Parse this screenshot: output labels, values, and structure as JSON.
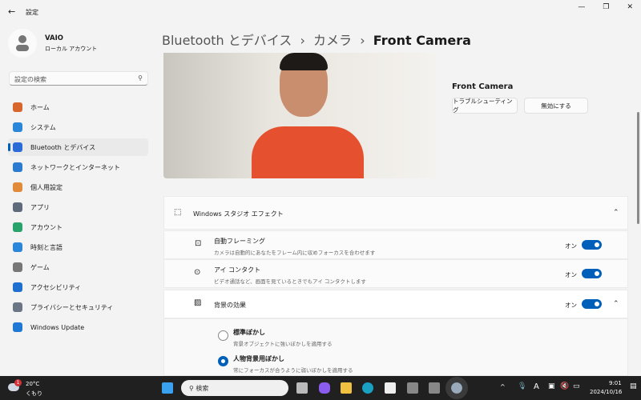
{
  "window": {
    "title": "設定",
    "back": "←",
    "minimize": "—",
    "maximize": "❐",
    "close": "✕"
  },
  "profile": {
    "name": "VAIO",
    "account": "ローカル アカウント"
  },
  "search": {
    "placeholder": "設定の検索"
  },
  "nav": [
    {
      "label": "ホーム",
      "color": "#d8652b"
    },
    {
      "label": "システム",
      "color": "#2a86d8"
    },
    {
      "label": "Bluetooth とデバイス",
      "color": "#2a6bd8",
      "active": true
    },
    {
      "label": "ネットワークとインターネット",
      "color": "#2b7bd0"
    },
    {
      "label": "個人用設定",
      "color": "#e08a3a"
    },
    {
      "label": "アプリ",
      "color": "#5f6b7a"
    },
    {
      "label": "アカウント",
      "color": "#28a36b"
    },
    {
      "label": "時刻と言語",
      "color": "#2a86d8"
    },
    {
      "label": "ゲーム",
      "color": "#777777"
    },
    {
      "label": "アクセシビリティ",
      "color": "#1e6fcf"
    },
    {
      "label": "プライバシーとセキュリティ",
      "color": "#6b7684"
    },
    {
      "label": "Windows Update",
      "color": "#1e78d4"
    }
  ],
  "breadcrumb": {
    "part1": "Bluetooth とデバイス",
    "sep": "›",
    "part2": "カメラ",
    "part3": "Front Camera"
  },
  "camera": {
    "name": "Front Camera",
    "troubleshoot": "トラブルシューティング",
    "disable": "無効にする"
  },
  "studio": {
    "title": "Windows スタジオ エフェクト",
    "auto_framing": {
      "title": "自動フレーミング",
      "desc": "カメラは自動的にあなたをフレーム内に収めフォーカスを合わせます",
      "state": "オン"
    },
    "eye_contact": {
      "title": "アイ コンタクト",
      "desc": "ビデオ通話など、画面を見ているときでもアイ コンタクトします",
      "state": "オン"
    },
    "background": {
      "title": "背景の効果",
      "state": "オン",
      "standard": {
        "title": "標準ぼかし",
        "desc": "背景オブジェクトに強いぼかしを適用する"
      },
      "portrait": {
        "title": "人物背景用ぼかし",
        "desc": "常にフォーカスが合うように弱いぼかしを適用する"
      }
    }
  },
  "taskbar": {
    "temp": "20°C",
    "weather": "くもり",
    "badge": "1",
    "search": "検索",
    "ime": "A",
    "time": "9:01",
    "date": "2024/10/16"
  }
}
